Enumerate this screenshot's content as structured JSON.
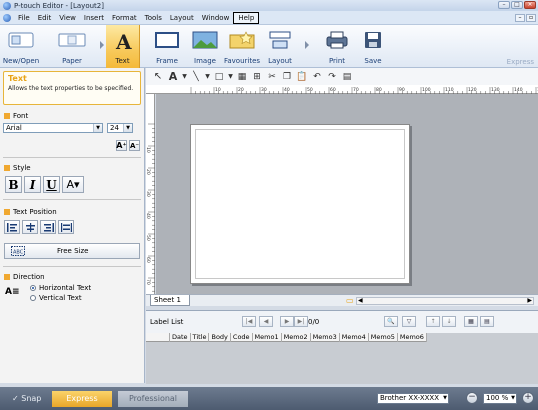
{
  "window": {
    "title": "P-touch Editor - [Layout2]"
  },
  "menubar": {
    "items": [
      "File",
      "Edit",
      "View",
      "Insert",
      "Format",
      "Tools",
      "Layout",
      "Window",
      "Help"
    ]
  },
  "ribbon": {
    "buttons": [
      "New/Open",
      "Paper",
      "Text",
      "Frame",
      "Image",
      "Favourites",
      "Layout",
      "Print",
      "Save"
    ],
    "express_label": "Express"
  },
  "panel": {
    "title": "Text",
    "description": "Allows the text properties to be specified.",
    "font_section": "Font",
    "font_name": "Arial",
    "font_size": "24",
    "style_section": "Style",
    "text_position_section": "Text Position",
    "free_size_label": "Free Size",
    "direction_section": "Direction",
    "direction_options": [
      "Horizontal Text",
      "Vertical Text"
    ]
  },
  "ruler": {
    "h_ticks": [
      "10",
      "20",
      "30",
      "40",
      "50",
      "60",
      "70",
      "80",
      "90",
      "100",
      "110",
      "120",
      "130",
      "140",
      "150"
    ],
    "v_ticks": [
      "10",
      "20",
      "30",
      "40",
      "50",
      "60",
      "70",
      "80"
    ]
  },
  "sheet": {
    "tab_label": "Sheet 1"
  },
  "database": {
    "label": "Label List",
    "count": "0/0",
    "columns": [
      "Date",
      "Title",
      "Body",
      "Code",
      "Memo1",
      "Memo2",
      "Memo3",
      "Memo4",
      "Memo5",
      "Memo6"
    ]
  },
  "statusbar": {
    "snap_label": "Snap",
    "express_label": "Express",
    "professional_label": "Professional",
    "printer": "Brother XX-XXXX",
    "zoom": "100 %"
  },
  "colors": {
    "accent": "#f0a830",
    "ribbon_text": "#1c3f76",
    "status_bg": "#4d5b70"
  }
}
